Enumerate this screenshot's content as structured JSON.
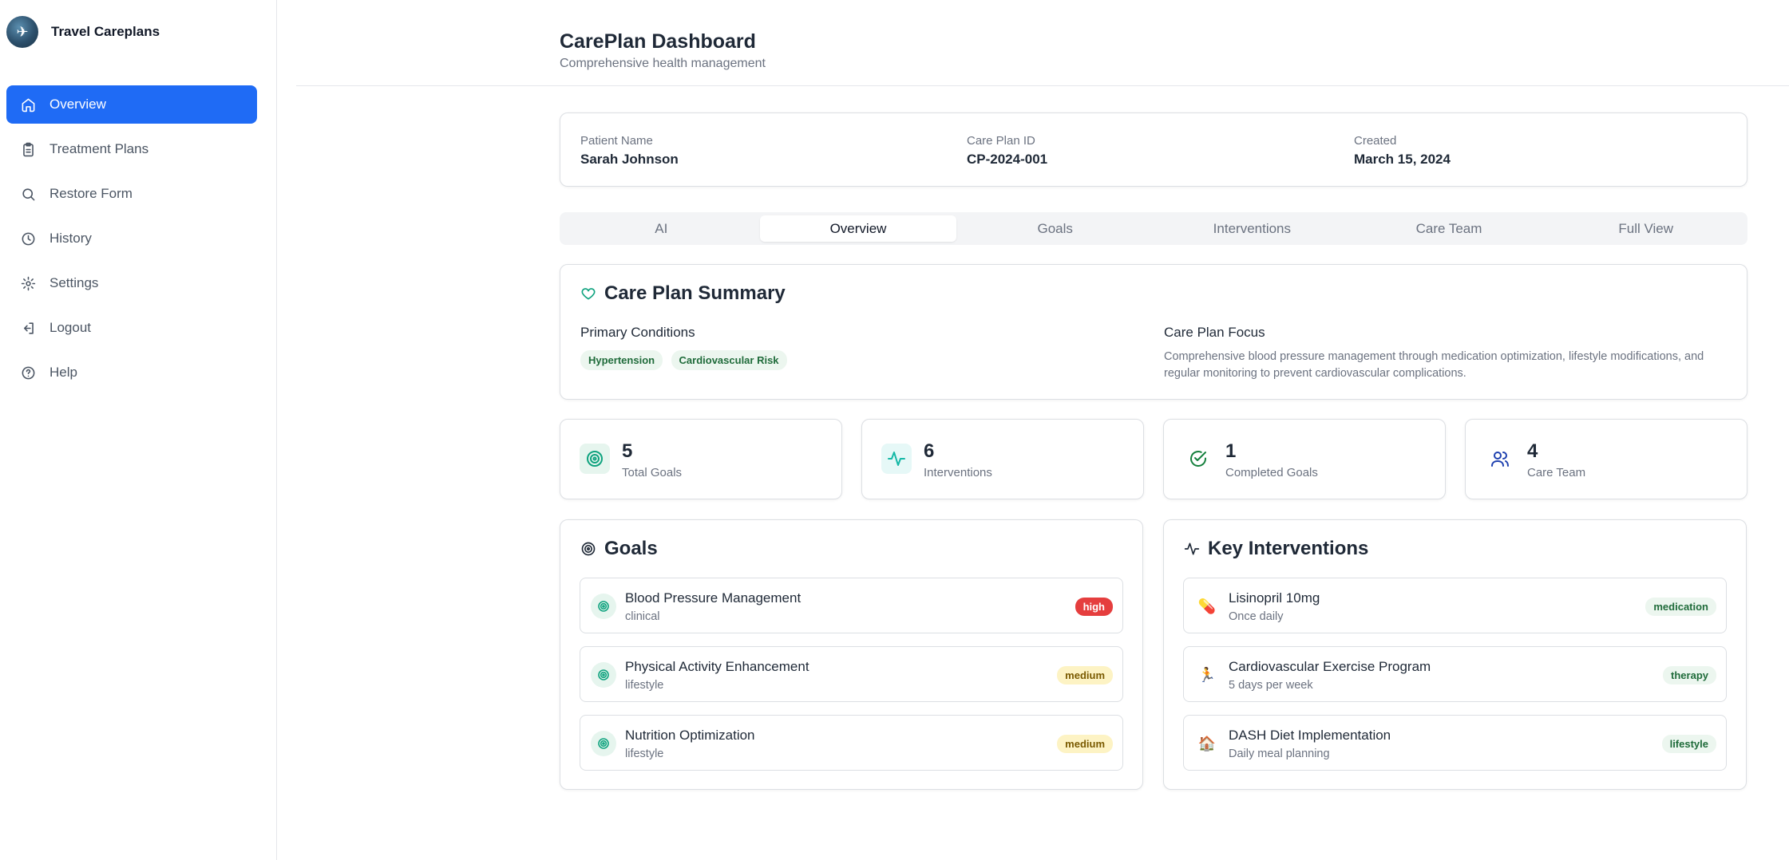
{
  "brand": {
    "name": "Travel Careplans",
    "logo_icon": "airplane-globe-icon"
  },
  "nav": [
    {
      "label": "Overview",
      "icon": "home-icon",
      "active": true
    },
    {
      "label": "Treatment Plans",
      "icon": "clipboard-icon",
      "active": false
    },
    {
      "label": "Restore Form",
      "icon": "search-icon",
      "active": false
    },
    {
      "label": "History",
      "icon": "clock-icon",
      "active": false
    },
    {
      "label": "Settings",
      "icon": "gear-icon",
      "active": false
    },
    {
      "label": "Logout",
      "icon": "logout-icon",
      "active": false
    },
    {
      "label": "Help",
      "icon": "help-circle-icon",
      "active": false
    }
  ],
  "header": {
    "title": "CarePlan Dashboard",
    "subtitle": "Comprehensive health management"
  },
  "patient": {
    "name_label": "Patient Name",
    "name_value": "Sarah Johnson",
    "id_label": "Care Plan ID",
    "id_value": "CP-2024-001",
    "created_label": "Created",
    "created_value": "March 15, 2024"
  },
  "tabs": [
    {
      "label": "AI",
      "active": false
    },
    {
      "label": "Overview",
      "active": true
    },
    {
      "label": "Goals",
      "active": false
    },
    {
      "label": "Interventions",
      "active": false
    },
    {
      "label": "Care Team",
      "active": false
    },
    {
      "label": "Full View",
      "active": false
    }
  ],
  "summary": {
    "title": "Care Plan Summary",
    "conditions_heading": "Primary Conditions",
    "conditions": [
      "Hypertension",
      "Cardiovascular Risk"
    ],
    "focus_heading": "Care Plan Focus",
    "focus_text": "Comprehensive blood pressure management through medication optimization, lifestyle modifications, and regular monitoring to prevent cardiovascular complications."
  },
  "stats": [
    {
      "value": "5",
      "label": "Total Goals",
      "icon": "target-icon"
    },
    {
      "value": "6",
      "label": "Interventions",
      "icon": "activity-icon"
    },
    {
      "value": "1",
      "label": "Completed Goals",
      "icon": "check-circle-icon"
    },
    {
      "value": "4",
      "label": "Care Team",
      "icon": "users-icon"
    }
  ],
  "goals": {
    "title": "Goals",
    "items": [
      {
        "title": "Blood Pressure Management",
        "category": "clinical",
        "priority": "high"
      },
      {
        "title": "Physical Activity Enhancement",
        "category": "lifestyle",
        "priority": "medium"
      },
      {
        "title": "Nutrition Optimization",
        "category": "lifestyle",
        "priority": "medium"
      }
    ]
  },
  "interventions": {
    "title": "Key Interventions",
    "items": [
      {
        "title": "Lisinopril 10mg",
        "detail": "Once daily",
        "type": "medication",
        "emoji": "💊"
      },
      {
        "title": "Cardiovascular Exercise Program",
        "detail": "5 days per week",
        "type": "therapy",
        "emoji": "🏃"
      },
      {
        "title": "DASH Diet Implementation",
        "detail": "Daily meal planning",
        "type": "lifestyle",
        "emoji": "🏠"
      }
    ]
  },
  "colors": {
    "primary": "#1f6bf5",
    "accent_green": "#10a37f",
    "high": "#e53e3e",
    "medium_bg": "#fdf3c4"
  }
}
